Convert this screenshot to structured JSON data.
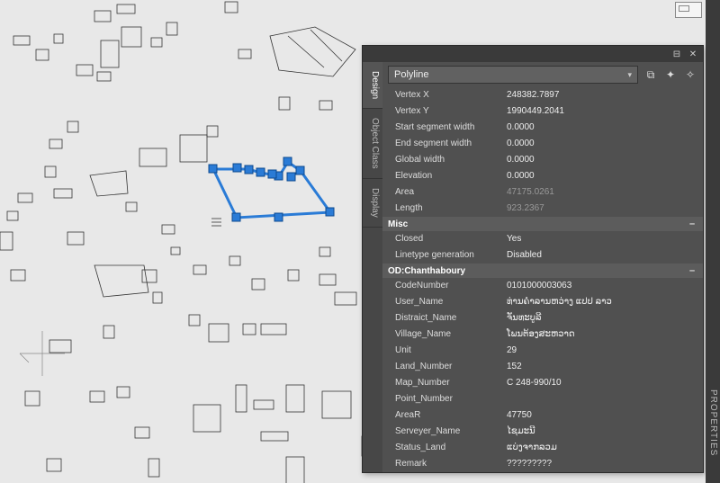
{
  "properties_tab_label": "PROPERTIES",
  "panel": {
    "selector": "Polyline",
    "side_tabs": {
      "design": "Design",
      "object_class": "Object Class",
      "display": "Display"
    },
    "sections": {
      "geometry": {
        "rows": [
          {
            "k": "Vertex X",
            "v": "248382.7897"
          },
          {
            "k": "Vertex Y",
            "v": "1990449.2041"
          },
          {
            "k": "Start segment width",
            "v": "0.0000"
          },
          {
            "k": "End segment width",
            "v": "0.0000"
          },
          {
            "k": "Global width",
            "v": "0.0000"
          },
          {
            "k": "Elevation",
            "v": "0.0000"
          },
          {
            "k": "Area",
            "v": "47175.0261",
            "dim": true
          },
          {
            "k": "Length",
            "v": "923.2367",
            "dim": true
          }
        ]
      },
      "misc": {
        "title": "Misc",
        "rows": [
          {
            "k": "Closed",
            "v": "Yes"
          },
          {
            "k": "Linetype generation",
            "v": "Disabled"
          }
        ]
      },
      "od": {
        "title": "OD:Chanthaboury",
        "rows": [
          {
            "k": "CodeNumber",
            "v": "0101000003063"
          },
          {
            "k": "User_Name",
            "v": "ທ່ານຄຳລານຫວ່າງ ແປປ ລາວ"
          },
          {
            "k": "Distraict_Name",
            "v": "ຈັນທະບູລີ"
          },
          {
            "k": "Village_Name",
            "v": "ໂພນຕ້ອງສະຫວາດ"
          },
          {
            "k": "Unit",
            "v": "29"
          },
          {
            "k": "Land_Number",
            "v": "152"
          },
          {
            "k": "Map_Number",
            "v": "C 248-990/10"
          },
          {
            "k": "Point_Number",
            "v": ""
          },
          {
            "k": "AreaR",
            "v": "47750"
          },
          {
            "k": "Serveyer_Name",
            "v": "ໄຊມະນີ"
          },
          {
            "k": "Status_Land",
            "v": "ແບ່ງຈາກລວມ"
          },
          {
            "k": "Remark",
            "v": "?????????"
          }
        ]
      }
    }
  }
}
